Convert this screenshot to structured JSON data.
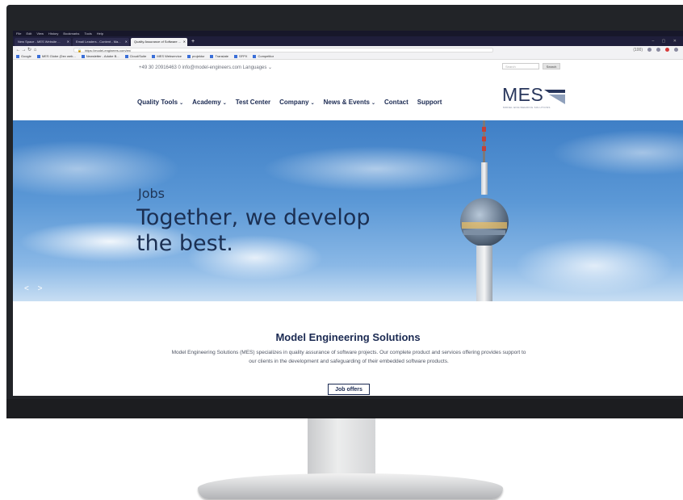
{
  "browser": {
    "menu": [
      "File",
      "Edit",
      "View",
      "History",
      "Bookmarks",
      "Tools",
      "Help"
    ],
    "tabs": [
      {
        "label": "New Space - MES Website ...",
        "active": false
      },
      {
        "label": "Email Leaders - Content - Ma...",
        "active": false
      },
      {
        "label": "Quality Assurance of Software ...",
        "active": true
      }
    ],
    "new_tab": "+",
    "url": "https://model-engineers.com/en/",
    "zoom": "(100)",
    "bookmarks": [
      "Google",
      "MES Globe (Dev web...",
      "Newsletter - Adobe B...",
      "Cloud/Suite",
      "MES Webservice",
      "projektor",
      "Translate",
      "SFPX",
      "Competitor"
    ]
  },
  "site": {
    "topbar": {
      "contact": "+49 30 20916463 0    info@model-engineers.com    Languages ⌄",
      "search_placeholder": "Search",
      "search_button": "Search"
    },
    "nav": [
      {
        "label": "Quality Tools",
        "dropdown": true
      },
      {
        "label": "Academy",
        "dropdown": true
      },
      {
        "label": "Test Center",
        "dropdown": false
      },
      {
        "label": "Company",
        "dropdown": true
      },
      {
        "label": "News & Events",
        "dropdown": true
      },
      {
        "label": "Contact",
        "dropdown": false
      },
      {
        "label": "Support",
        "dropdown": false
      }
    ],
    "logo": {
      "text": "MES",
      "subtitle": "MODEL ENGINEERING SOLUTIONS"
    },
    "hero": {
      "kicker": "Jobs",
      "title": "Together, we develop the best.",
      "prev": "<",
      "next": ">"
    },
    "content": {
      "title": "Model Engineering Solutions",
      "text": "Model Engineering Solutions (MES) specializes in quality assurance of software projects. Our complete product and services offering provides support to our clients in the development and safeguarding of their embedded software products.",
      "button": "Job offers"
    }
  },
  "colors": {
    "brand_navy": "#1b2a52",
    "browser_dark": "#1f1e3a",
    "sky": "#5b98d6"
  }
}
